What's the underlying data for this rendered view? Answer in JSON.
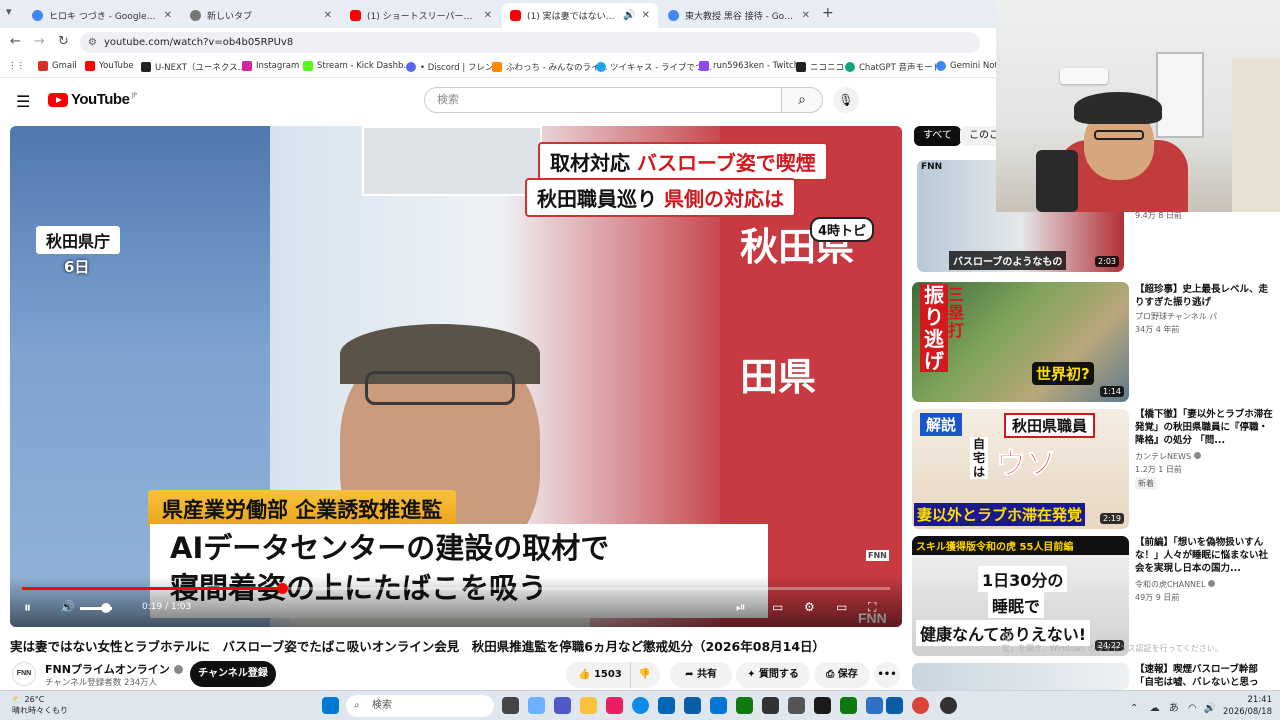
{
  "tabs": [
    {
      "label": "ヒロキ つづき - Google 検索",
      "favicon": "google-icon",
      "color": "#4285f4"
    },
    {
      "label": "新しいタブ",
      "favicon": "chrome-icon",
      "color": "#777777"
    },
    {
      "label": "(1) ショートスリーパー堀大輔/25歳",
      "favicon": "youtube-icon",
      "color": "#ff0000"
    },
    {
      "label": "(1) 実は妻ではない女性とラブホ",
      "favicon": "youtube-icon",
      "color": "#ff0000",
      "active": true
    },
    {
      "label": "東大教授 黒谷 接待 - Google 検索",
      "favicon": "google-icon",
      "color": "#4285f4"
    }
  ],
  "address": "youtube.com/watch?v=ob4b05RPUv8",
  "bookmarks": [
    {
      "label": "Gmail",
      "color": "#d93025"
    },
    {
      "label": "YouTube",
      "color": "#ff0000"
    },
    {
      "label": "U-NEXT（ユーネクス...",
      "color": "#222222"
    },
    {
      "label": "Instagram",
      "color": "#d6249f"
    },
    {
      "label": "Stream - Kick Dashb...",
      "color": "#53fc18"
    },
    {
      "label": "• Discord | フレンド",
      "color": "#5865f2"
    },
    {
      "label": "ふわっち - みんなのライ...",
      "color": "#ff8a00"
    },
    {
      "label": "ツイキャス - ライブでつ...",
      "color": "#1da1f2"
    },
    {
      "label": "run5963ken - Twitch",
      "color": "#9146ff"
    },
    {
      "label": "ニコニコ",
      "color": "#222222"
    },
    {
      "label": "ChatGPT 音声モード",
      "color": "#10a37f"
    },
    {
      "label": "Gemini Note",
      "color": "#4285f4"
    }
  ],
  "header": {
    "logo": "YouTube",
    "region": "JP",
    "search_placeholder": "検索"
  },
  "video": {
    "caption_line1_black": "取材対応 ",
    "caption_line1_red": "バスローブ姿で喫煙",
    "caption_line2_black": "秋田職員巡り ",
    "caption_line2_red": "県側の対応は",
    "time_badge": "4時トピ",
    "location": "秋田県庁",
    "date": "6日",
    "wall_text_1": "秋田県",
    "wall_text_2": "田県",
    "dept": "県産業労働部 企業誘致推進監",
    "subtitle_1": "AIデータセンターの建設の取材で",
    "subtitle_2": "寝間着姿の上にたばこを吸う",
    "watermark": "FNN",
    "progress": 0.3,
    "volume": 0.8,
    "time_current": "0:19",
    "time_total": "1:03"
  },
  "title": "実は妻ではない女性とラブホテルに　バスローブ姿でたばこ吸いオンライン会見　秋田県推進監を停職6ヵ月など懲戒処分（2026年08月14日）",
  "channel": {
    "avatar_text": "FNN",
    "name": "FNNプライムオンライン",
    "subscribers": "チャンネル登録者数 234万人",
    "subscribe_label": "チャンネル登録"
  },
  "actions": {
    "likes": "1503",
    "share": "共有",
    "ask": "質問する",
    "save": "保存",
    "more": "•••"
  },
  "chips": {
    "all": "すべて",
    "this": "このこ"
  },
  "recommended": [
    {
      "thumb_text": "バスローブのようなもの",
      "duration": "2:03",
      "meta": "9.4万 8 日前",
      "brand": "FNN",
      "title": "",
      "channel": ""
    },
    {
      "title": "【超珍事】史上最長レベル、走りすぎた振り逃げ",
      "channel": "プロ野球チャンネル パ",
      "meta": "34万  4 年前",
      "duration": "1:14",
      "thumb_text": "振り逃げ",
      "thumb_text2": "三塁打",
      "thumb_text3": "世界初?"
    },
    {
      "title": "【橋下徹】「妻以外とラブホ滞在発覚」の秋田県職員に『停職・降格』の処分 「問...",
      "channel": "カンテレNEWS",
      "meta": "1.2万  1 日前",
      "badge": "新着",
      "duration": "2:19",
      "thumb_text": "秋田県職員",
      "thumb_text2": "妻以外とラブホ滞在発覚",
      "thumb_text3": "解説",
      "thumb_text4": "ウソ",
      "thumb_text5": "自宅は"
    },
    {
      "title": "【前編】「想いを偽物扱いすんな！」人々が睡眠に悩まない社会を実現し日本の国力...",
      "channel": "令和の虎CHANNEL",
      "meta": "49万  9 日前",
      "duration": "24:22",
      "thumb_text": "スキル獲得版令和の虎 55人目前編",
      "thumb_text2": "1日30分の",
      "thumb_text3": "睡眠で",
      "thumb_text4": "健康なんてありえない!"
    },
    {
      "title": "【速報】喫煙バスローブ幹部「自宅は嘘、バレないと思っ",
      "channel": "",
      "meta": "",
      "duration": ""
    }
  ],
  "windows_watermark": {
    "line1": "証",
    "line2": "定」を開き、Windows のライセンス認証を行ってください。"
  },
  "taskbar": {
    "temp": "26°C",
    "weather": "晴れ時々くもり",
    "search": "検索",
    "time": "21:41",
    "date": "2026/08/18",
    "ime": "あ"
  }
}
